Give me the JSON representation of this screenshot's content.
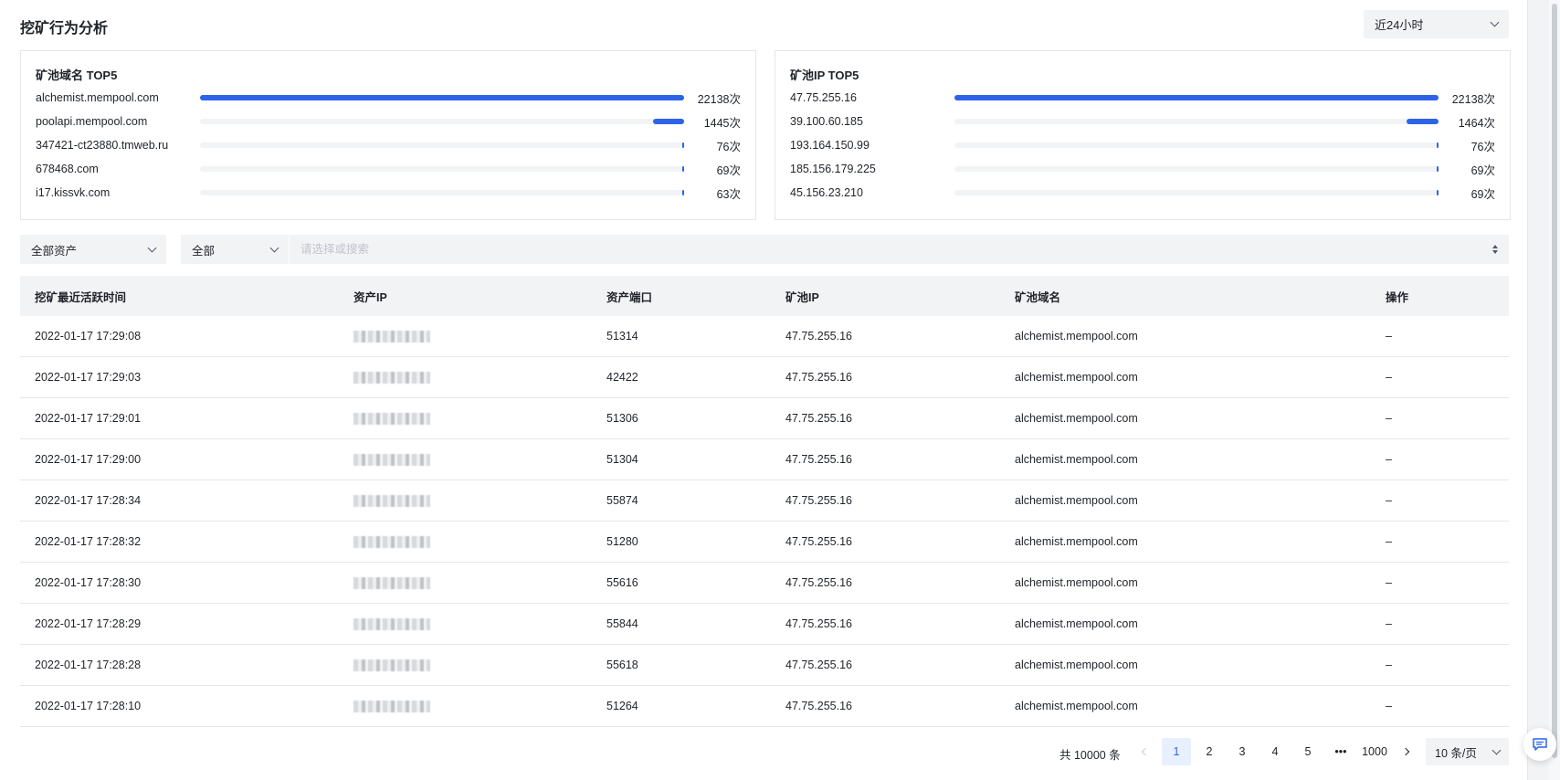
{
  "header": {
    "title": "挖矿行为分析",
    "time_range": "近24小时"
  },
  "domain_top5": {
    "title": "矿池域名 TOP5",
    "items": [
      {
        "label": "alchemist.mempool.com",
        "value": "22138次",
        "ratio": 1.0
      },
      {
        "label": "poolapi.mempool.com",
        "value": "1445次",
        "ratio": 0.065
      },
      {
        "label": "347421-ct23880.tmweb.ru",
        "value": "76次",
        "ratio": 0.0034
      },
      {
        "label": "678468.com",
        "value": "69次",
        "ratio": 0.0031
      },
      {
        "label": "i17.kissvk.com",
        "value": "63次",
        "ratio": 0.0028
      }
    ]
  },
  "ip_top5": {
    "title": "矿池IP TOP5",
    "items": [
      {
        "label": "47.75.255.16",
        "value": "22138次",
        "ratio": 1.0
      },
      {
        "label": "39.100.60.185",
        "value": "1464次",
        "ratio": 0.066
      },
      {
        "label": "193.164.150.99",
        "value": "76次",
        "ratio": 0.0034
      },
      {
        "label": "185.156.179.225",
        "value": "69次",
        "ratio": 0.0031
      },
      {
        "label": "45.156.23.210",
        "value": "69次",
        "ratio": 0.0031
      }
    ]
  },
  "filters": {
    "asset": "全部资产",
    "type": "全部",
    "search_placeholder": "请选择或搜索"
  },
  "table": {
    "columns": [
      "挖矿最近活跃时间",
      "资产IP",
      "资产端口",
      "矿池IP",
      "矿池域名",
      "操作"
    ],
    "rows": [
      {
        "time": "2022-01-17 17:29:08",
        "port": "51314",
        "pool_ip": "47.75.255.16",
        "domain": "alchemist.mempool.com",
        "action": "–"
      },
      {
        "time": "2022-01-17 17:29:03",
        "port": "42422",
        "pool_ip": "47.75.255.16",
        "domain": "alchemist.mempool.com",
        "action": "–"
      },
      {
        "time": "2022-01-17 17:29:01",
        "port": "51306",
        "pool_ip": "47.75.255.16",
        "domain": "alchemist.mempool.com",
        "action": "–"
      },
      {
        "time": "2022-01-17 17:29:00",
        "port": "51304",
        "pool_ip": "47.75.255.16",
        "domain": "alchemist.mempool.com",
        "action": "–"
      },
      {
        "time": "2022-01-17 17:28:34",
        "port": "55874",
        "pool_ip": "47.75.255.16",
        "domain": "alchemist.mempool.com",
        "action": "–"
      },
      {
        "time": "2022-01-17 17:28:32",
        "port": "51280",
        "pool_ip": "47.75.255.16",
        "domain": "alchemist.mempool.com",
        "action": "–"
      },
      {
        "time": "2022-01-17 17:28:30",
        "port": "55616",
        "pool_ip": "47.75.255.16",
        "domain": "alchemist.mempool.com",
        "action": "–"
      },
      {
        "time": "2022-01-17 17:28:29",
        "port": "55844",
        "pool_ip": "47.75.255.16",
        "domain": "alchemist.mempool.com",
        "action": "–"
      },
      {
        "time": "2022-01-17 17:28:28",
        "port": "55618",
        "pool_ip": "47.75.255.16",
        "domain": "alchemist.mempool.com",
        "action": "–"
      },
      {
        "time": "2022-01-17 17:28:10",
        "port": "51264",
        "pool_ip": "47.75.255.16",
        "domain": "alchemist.mempool.com",
        "action": "–"
      }
    ]
  },
  "pagination": {
    "total": "共 10000 条",
    "pages": [
      "1",
      "2",
      "3",
      "4",
      "5"
    ],
    "current": "1",
    "ellipsis": "•••",
    "last": "1000",
    "page_size": "10 条/页"
  },
  "colors": {
    "accent": "#2c63e9",
    "track": "#f2f3f5",
    "border": "#e5e6eb"
  },
  "icons": {
    "time_select": "chevron-down-icon",
    "feedback": "message-icon"
  }
}
